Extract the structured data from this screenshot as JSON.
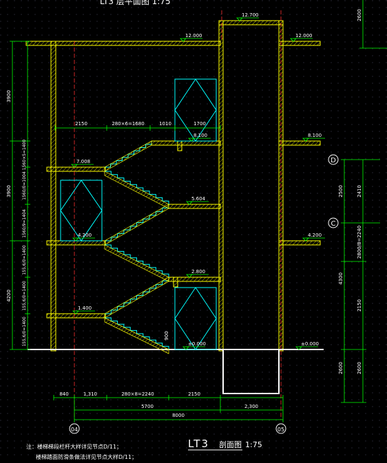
{
  "title": {
    "code": "LT3",
    "suffix": "剖面图",
    "scale": "1:75",
    "top_cut": "LT3 层平面图 1:75"
  },
  "elevations": {
    "top_lift": "12.700",
    "roof_left": "12.000",
    "roof_right": "12.000",
    "f3_mid": "8.100",
    "f3_right": "8.100",
    "land_7": "7.008",
    "land_5": "5.604",
    "f2_mid": "4.200",
    "f2_right": "4.200",
    "land_2": "2.800",
    "land_1": "1.400",
    "ground_mid": "±0.000",
    "ground_right": "±0.000",
    "wall_mark": "900"
  },
  "dims_left": [
    "3900",
    "1560×5=1400",
    "1560/0=1004",
    "1560/9=1404",
    "155,6/0=1400",
    "155,6/0=1400",
    "155,6/0=1400",
    "3900",
    "4200"
  ],
  "dims_right_top": [
    "2600"
  ],
  "dims_right": [
    "2500",
    "2410",
    "4300",
    "2800/8=2240",
    "2150",
    "2600",
    "2600"
  ],
  "dims_upper": [
    "2150",
    "280×6=1680",
    "1010",
    "1700"
  ],
  "dims_bottom_row1": [
    "840",
    "1,310",
    "280×8=2240",
    "2150",
    "2,300"
  ],
  "dims_bottom_row2": [
    "5700"
  ],
  "dims_bottom_row3": [
    "8000"
  ],
  "axes": {
    "d": "D",
    "c": "C",
    "a4": "04",
    "a5": "05"
  },
  "notes": [
    "注：楼梯梯段栏杆大样详见节点D/11；",
    "楼梯踏面防滑条做法详见节点大样D/11；"
  ],
  "colors": {
    "bg": "#000000",
    "wall": "#ffff00",
    "dim": "#00ff00",
    "stair": "#00ffff",
    "text": "#ffffff",
    "grid": "#4a4a60",
    "red": "#ff3030"
  }
}
